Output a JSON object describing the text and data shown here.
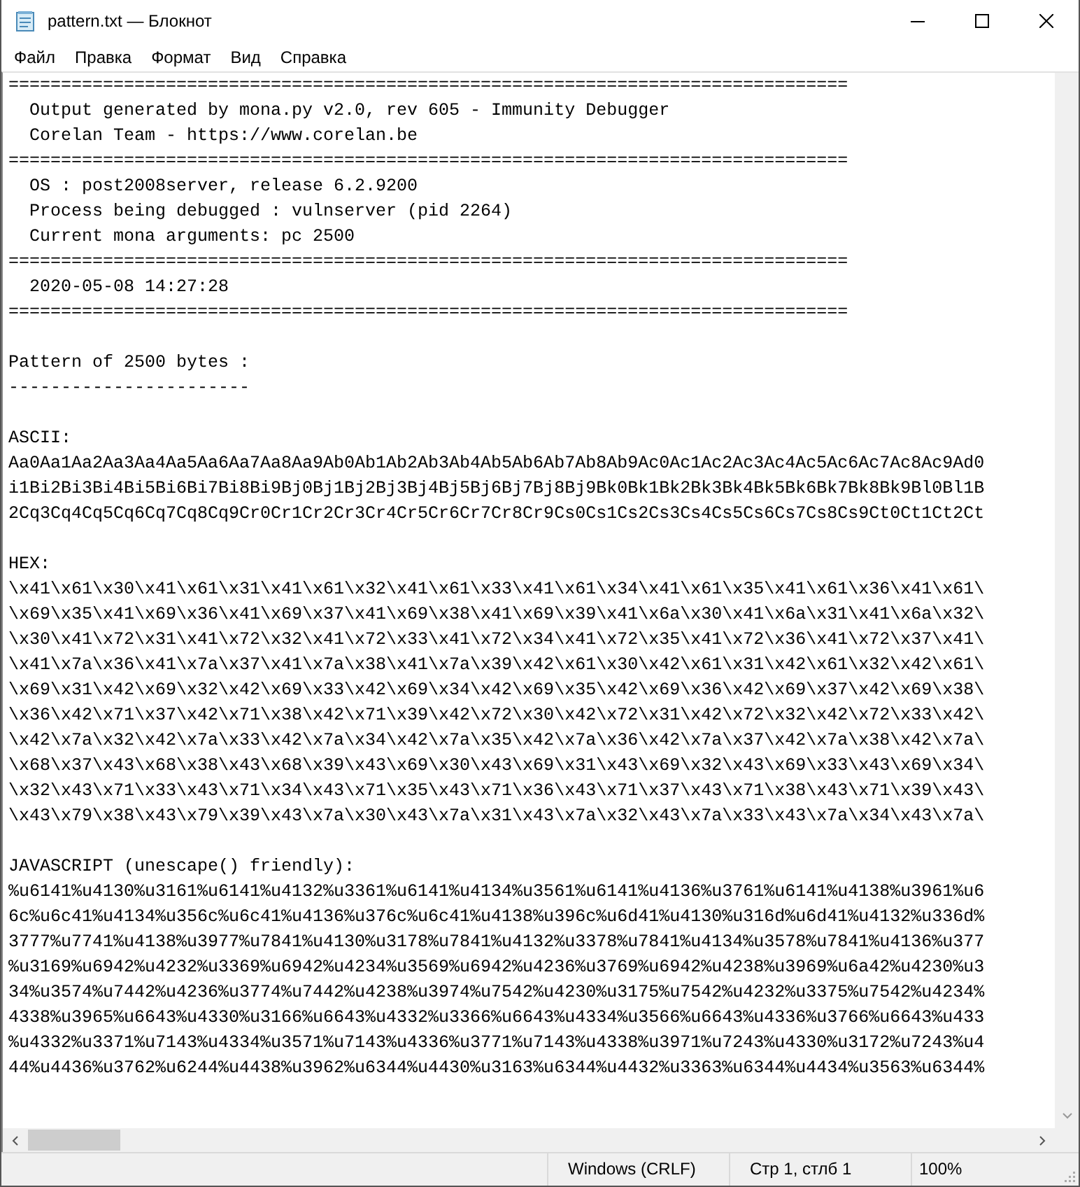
{
  "window": {
    "title": "pattern.txt — Блокнот"
  },
  "menu": [
    {
      "label": "Файл"
    },
    {
      "label": "Правка"
    },
    {
      "label": "Формат"
    },
    {
      "label": "Вид"
    },
    {
      "label": "Справка"
    }
  ],
  "document": {
    "blocks": [
      {
        "lines": [
          "================================================================================",
          "  Output generated by mona.py v2.0, rev 605 - Immunity Debugger",
          "  Corelan Team - https://www.corelan.be",
          "================================================================================",
          "  OS : post2008server, release 6.2.9200",
          "  Process being debugged : vulnserver (pid 2264)",
          "  Current mona arguments: pc 2500",
          "================================================================================",
          "  2020-05-08 14:27:28",
          "================================================================================"
        ]
      },
      {
        "lines": [
          "Pattern of 2500 bytes :",
          "-----------------------"
        ]
      },
      {
        "lines": [
          "ASCII:",
          "Aa0Aa1Aa2Aa3Aa4Aa5Aa6Aa7Aa8Aa9Ab0Ab1Ab2Ab3Ab4Ab5Ab6Ab7Ab8Ab9Ac0Ac1Ac2Ac3Ac4Ac5Ac6Ac7Ac8Ac9Ad0",
          "i1Bi2Bi3Bi4Bi5Bi6Bi7Bi8Bi9Bj0Bj1Bj2Bj3Bj4Bj5Bj6Bj7Bj8Bj9Bk0Bk1Bk2Bk3Bk4Bk5Bk6Bk7Bk8Bk9Bl0Bl1B",
          "2Cq3Cq4Cq5Cq6Cq7Cq8Cq9Cr0Cr1Cr2Cr3Cr4Cr5Cr6Cr7Cr8Cr9Cs0Cs1Cs2Cs3Cs4Cs5Cs6Cs7Cs8Cs9Ct0Ct1Ct2Ct"
        ]
      },
      {
        "lines": [
          "HEX:",
          "\\x41\\x61\\x30\\x41\\x61\\x31\\x41\\x61\\x32\\x41\\x61\\x33\\x41\\x61\\x34\\x41\\x61\\x35\\x41\\x61\\x36\\x41\\x61\\",
          "\\x69\\x35\\x41\\x69\\x36\\x41\\x69\\x37\\x41\\x69\\x38\\x41\\x69\\x39\\x41\\x6a\\x30\\x41\\x6a\\x31\\x41\\x6a\\x32\\",
          "\\x30\\x41\\x72\\x31\\x41\\x72\\x32\\x41\\x72\\x33\\x41\\x72\\x34\\x41\\x72\\x35\\x41\\x72\\x36\\x41\\x72\\x37\\x41\\",
          "\\x41\\x7a\\x36\\x41\\x7a\\x37\\x41\\x7a\\x38\\x41\\x7a\\x39\\x42\\x61\\x30\\x42\\x61\\x31\\x42\\x61\\x32\\x42\\x61\\",
          "\\x69\\x31\\x42\\x69\\x32\\x42\\x69\\x33\\x42\\x69\\x34\\x42\\x69\\x35\\x42\\x69\\x36\\x42\\x69\\x37\\x42\\x69\\x38\\",
          "\\x36\\x42\\x71\\x37\\x42\\x71\\x38\\x42\\x71\\x39\\x42\\x72\\x30\\x42\\x72\\x31\\x42\\x72\\x32\\x42\\x72\\x33\\x42\\",
          "\\x42\\x7a\\x32\\x42\\x7a\\x33\\x42\\x7a\\x34\\x42\\x7a\\x35\\x42\\x7a\\x36\\x42\\x7a\\x37\\x42\\x7a\\x38\\x42\\x7a\\",
          "\\x68\\x37\\x43\\x68\\x38\\x43\\x68\\x39\\x43\\x69\\x30\\x43\\x69\\x31\\x43\\x69\\x32\\x43\\x69\\x33\\x43\\x69\\x34\\",
          "\\x32\\x43\\x71\\x33\\x43\\x71\\x34\\x43\\x71\\x35\\x43\\x71\\x36\\x43\\x71\\x37\\x43\\x71\\x38\\x43\\x71\\x39\\x43\\",
          "\\x43\\x79\\x38\\x43\\x79\\x39\\x43\\x7a\\x30\\x43\\x7a\\x31\\x43\\x7a\\x32\\x43\\x7a\\x33\\x43\\x7a\\x34\\x43\\x7a\\"
        ]
      },
      {
        "lines": [
          "JAVASCRIPT (unescape() friendly):",
          "%u6141%u4130%u3161%u6141%u4132%u3361%u6141%u4134%u3561%u6141%u4136%u3761%u6141%u4138%u3961%u6",
          "6c%u6c41%u4134%u356c%u6c41%u4136%u376c%u6c41%u4138%u396c%u6d41%u4130%u316d%u6d41%u4132%u336d%",
          "3777%u7741%u4138%u3977%u7841%u4130%u3178%u7841%u4132%u3378%u7841%u4134%u3578%u7841%u4136%u377",
          "%u3169%u6942%u4232%u3369%u6942%u4234%u3569%u6942%u4236%u3769%u6942%u4238%u3969%u6a42%u4230%u3",
          "34%u3574%u7442%u4236%u3774%u7442%u4238%u3974%u7542%u4230%u3175%u7542%u4232%u3375%u7542%u4234%",
          "4338%u3965%u6643%u4330%u3166%u6643%u4332%u3366%u6643%u4334%u3566%u6643%u4336%u3766%u6643%u433",
          "%u4332%u3371%u7143%u4334%u3571%u7143%u4336%u3771%u7143%u4338%u3971%u7243%u4330%u3172%u7243%u4",
          "44%u4436%u3762%u6244%u4438%u3962%u6344%u4430%u3163%u6344%u4432%u3363%u6344%u4434%u3563%u6344%"
        ]
      }
    ]
  },
  "status_bar": [
    "Windows (CRLF)",
    "Стр 1, стлб 1",
    "100%"
  ]
}
